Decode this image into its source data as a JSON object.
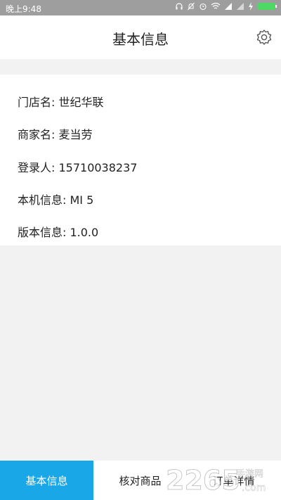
{
  "status_bar": {
    "time": "晚上9:48",
    "icons": [
      "headphones-icon",
      "bell-muted-icon",
      "alarm-icon",
      "wifi-icon",
      "signal-icon",
      "signal-icon",
      "charging-icon",
      "battery-icon"
    ]
  },
  "header": {
    "title": "基本信息",
    "settings_icon": "gear-icon"
  },
  "info": {
    "store": "门店名: 世纪华联",
    "merchant": "商家名: 麦当劳",
    "login_user": "登录人: 15710038237",
    "device": "本机信息: MI 5",
    "version": "版本信息: 1.0.0"
  },
  "bottom_nav": {
    "tabs": [
      {
        "label": "基本信息",
        "active": true
      },
      {
        "label": "核对商品",
        "active": false
      },
      {
        "label": "订单详情",
        "active": false
      }
    ]
  },
  "watermark": {
    "text": "2265",
    "subtext": "手游网",
    "domain": ".com"
  },
  "colors": {
    "accent": "#1aa7e8",
    "status_bar": "#9e9e9e",
    "background": "#f2f2f2",
    "battery": "#4cd964"
  }
}
